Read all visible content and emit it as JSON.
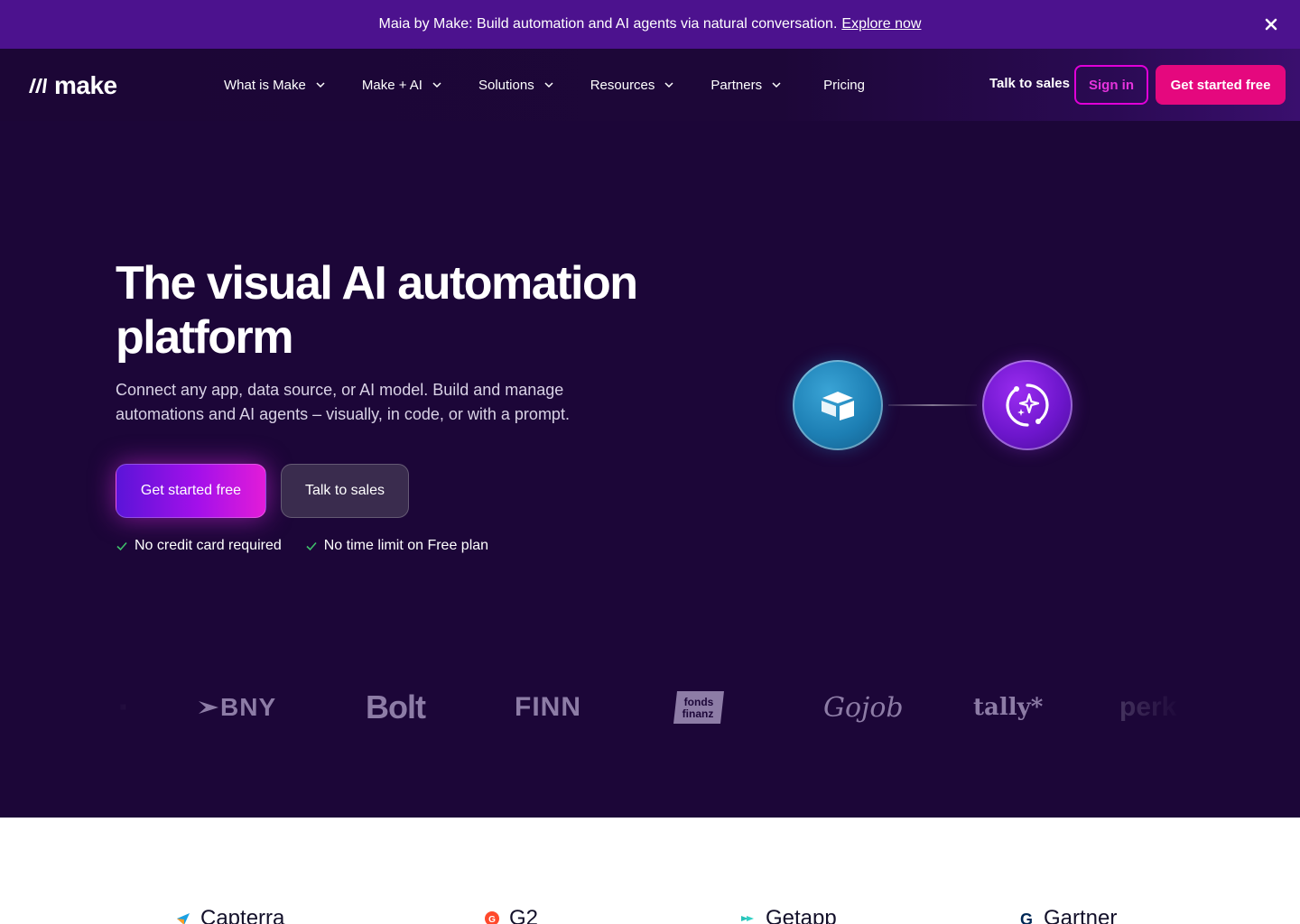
{
  "banner": {
    "text": "Maia by Make: Build automation and AI agents via natural conversation.",
    "link": "Explore now"
  },
  "header": {
    "logo": "make",
    "nav": [
      {
        "label": "What is Make"
      },
      {
        "label": "Make + AI"
      },
      {
        "label": "Solutions"
      },
      {
        "label": "Resources"
      },
      {
        "label": "Partners"
      },
      {
        "label": "Pricing"
      }
    ],
    "talk_to_sales": "Talk to sales",
    "sign_in": "Sign in",
    "get_started": "Get started free"
  },
  "hero": {
    "title": "The visual AI automation platform",
    "subtitle": "Connect any app, data source, or AI model. Build and manage automations and AI agents – visually, in code, or with a prompt.",
    "cta_primary": "Get started free",
    "cta_secondary": "Talk to sales",
    "checks": [
      "No credit card required",
      "No time limit on Free plan"
    ]
  },
  "logos": {
    "items": [
      "BNY",
      "Bolt",
      "FINN",
      "fonds finanz",
      "Gojob",
      "tally*",
      "perk"
    ]
  },
  "ratings": {
    "items": [
      "Capterra",
      "G2",
      "Getapp",
      "Gartner"
    ]
  },
  "colors": {
    "banner_bg": "#4c128e",
    "hero_bg": "#1c0638",
    "accent_pink": "#e5087e",
    "accent_magenta": "#e100d8"
  }
}
